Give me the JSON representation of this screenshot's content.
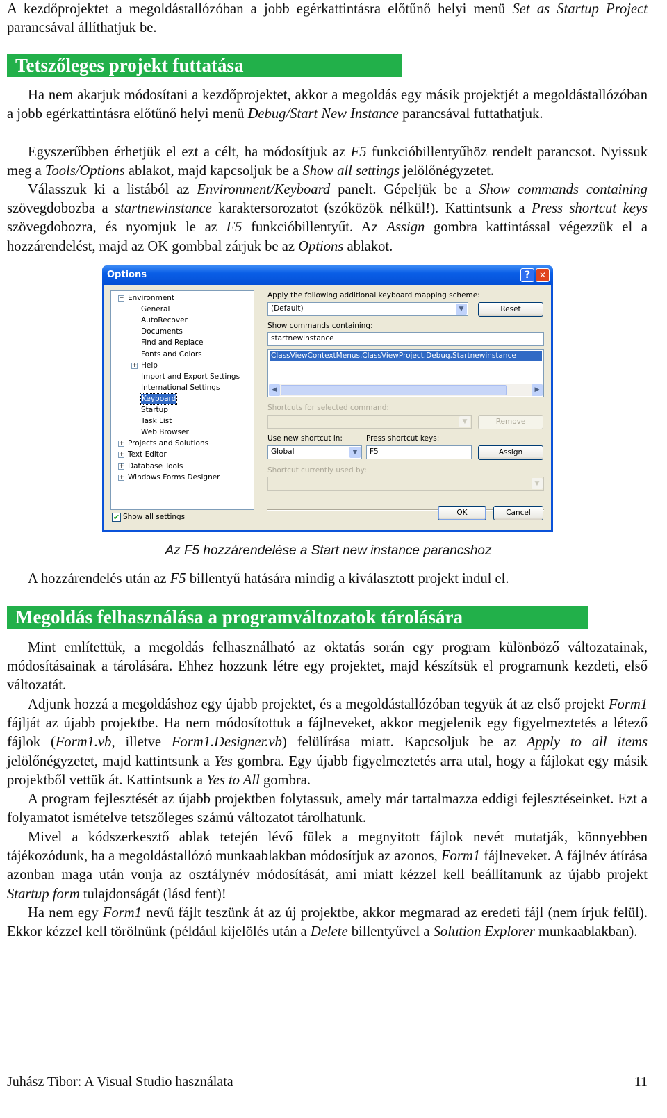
{
  "paragraphs": {
    "p0": [
      {
        "t": "A kezdőprojektet a megoldástallózóban a jobb egérkattintásra előtűnő helyi menü "
      },
      {
        "t": "Set as Startup Project",
        "i": true
      },
      {
        "t": " parancsával állíthatjuk be."
      }
    ],
    "p1": [
      {
        "t": "Ha nem akarjuk módosítani a kezdőprojektet, akkor a megoldás egy másik projektjét a megol­dástallózóban a jobb egérkattintásra előtűnő helyi menü "
      },
      {
        "t": "Debug/Start New Instance",
        "i": true
      },
      {
        "t": " parancsával futtathatjuk."
      }
    ],
    "p2": [
      {
        "t": "Egyszerűbben érhetjük el ezt a célt, ha módosítjuk az "
      },
      {
        "t": "F5",
        "i": true
      },
      {
        "t": " funkcióbillentyűhöz rendelt parancsot. Nyissuk meg a "
      },
      {
        "t": "Tools/Options",
        "i": true
      },
      {
        "t": " ablakot, majd kapcsoljuk be a "
      },
      {
        "t": "Show all settings",
        "i": true
      },
      {
        "t": " jelölőnégyzetet."
      }
    ],
    "p3": [
      {
        "t": "Válasszuk ki a listából az "
      },
      {
        "t": "Environment/Keyboard",
        "i": true
      },
      {
        "t": " panelt. Gépeljük be a "
      },
      {
        "t": "Show commands containing",
        "i": true
      },
      {
        "t": " szövegdobozba a "
      },
      {
        "t": "startnewinstance",
        "i": true
      },
      {
        "t": " karaktersorozatot (szóközök nélkül!). Kattintsunk a "
      },
      {
        "t": "Press shortcut keys",
        "i": true
      },
      {
        "t": " szövegdobozra, és nyomjuk le az "
      },
      {
        "t": "F5",
        "i": true
      },
      {
        "t": " funkcióbillentyűt. Az "
      },
      {
        "t": "Assign",
        "i": true
      },
      {
        "t": " gombra kat­tintással végezzük el a hozzárendelést, majd az OK gombbal zárjuk be az "
      },
      {
        "t": "Options",
        "i": true
      },
      {
        "t": " ablakot."
      }
    ],
    "p4": [
      {
        "t": "A hozzárendelés után az "
      },
      {
        "t": "F5",
        "i": true
      },
      {
        "t": " billentyű hatására mindig a kiválasztott projekt indul el."
      }
    ],
    "p5": [
      {
        "t": "Mint említettük, a megoldás felhasználható az oktatás során egy program különböző változatai­nak, módosításainak a tárolására. Ehhez hozzunk létre egy projektet, majd készítsük el programunk kezdeti, első változatát."
      }
    ],
    "p6": [
      {
        "t": "Adjunk hozzá a megoldáshoz egy újabb projektet, és a megoldástallózóban tegyük át az első projekt "
      },
      {
        "t": "Form1",
        "i": true
      },
      {
        "t": " fájlját az újabb projektbe. Ha nem módosítottuk a fájlneveket, akkor megjelenik egy figyelmeztetés a létező fájlok ("
      },
      {
        "t": "Form1.vb",
        "i": true
      },
      {
        "t": ", illetve "
      },
      {
        "t": "Form1.Designer.vb",
        "i": true
      },
      {
        "t": ") felülírása miatt. Kapcsoljuk be az "
      },
      {
        "t": "Apply to all items",
        "i": true
      },
      {
        "t": " jelölőnégyzetet, majd kattintsunk a "
      },
      {
        "t": "Yes",
        "i": true
      },
      {
        "t": " gombra. Egy újabb figyelmeztetés arra utal, hogy a fájlokat egy másik projektből vettük át. Kattintsunk a "
      },
      {
        "t": "Yes to All",
        "i": true
      },
      {
        "t": " gombra."
      }
    ],
    "p7": [
      {
        "t": "A program fejlesztését az újabb projektben folytassuk, amely már tartalmazza eddigi fejleszté­seinket. Ezt a folyamatot ismételve tetszőleges számú változatot tárolhatunk."
      }
    ],
    "p8": [
      {
        "t": "Mivel a kódszerkesztő ablak tetején lévő fülek a megnyitott fájlok nevét mutatják, könnyebben tájékozódunk, ha a megoldástallózó munkaablakban módosítjuk az azonos, "
      },
      {
        "t": "Form1",
        "i": true
      },
      {
        "t": " fájlneveket. A fájlnév átírása azonban maga után vonja az osztálynév módosítását, ami miatt kézzel kell beállíta­nunk az újabb projekt "
      },
      {
        "t": "Startup form",
        "i": true
      },
      {
        "t": " tulajdonságát (lásd fent)!"
      }
    ],
    "p9": [
      {
        "t": "Ha nem egy "
      },
      {
        "t": "Form1",
        "i": true
      },
      {
        "t": " nevű fájlt teszünk át az új projektbe, akkor megmarad az eredeti fájl (nem írjuk felül). Ekkor kézzel kell törölnünk (például kijelölés után a "
      },
      {
        "t": "Delete",
        "i": true
      },
      {
        "t": " billentyűvel a "
      },
      {
        "t": "Solution Explorer",
        "i": true
      },
      {
        "t": " munkaablakban)."
      }
    ]
  },
  "headings": {
    "h1": "Tetszőleges projekt futtatása",
    "h2": "Megoldás felhasználása a programváltozatok tárolására",
    "color": "#22b04a"
  },
  "caption": "Az F5 hozzárendelése a Start new instance parancshoz",
  "dialog": {
    "title": "Options",
    "help": "?",
    "close": "✕",
    "tree": [
      {
        "label": "Environment",
        "level": 0,
        "expander": "−"
      },
      {
        "label": "General",
        "level": 1
      },
      {
        "label": "AutoRecover",
        "level": 1
      },
      {
        "label": "Documents",
        "level": 1
      },
      {
        "label": "Find and Replace",
        "level": 1
      },
      {
        "label": "Fonts and Colors",
        "level": 1
      },
      {
        "label": "Help",
        "level": 1,
        "expander": "+"
      },
      {
        "label": "Import and Export Settings",
        "level": 1
      },
      {
        "label": "International Settings",
        "level": 1
      },
      {
        "label": "Keyboard",
        "level": 1,
        "selected": true
      },
      {
        "label": "Startup",
        "level": 1
      },
      {
        "label": "Task List",
        "level": 1
      },
      {
        "label": "Web Browser",
        "level": 1
      },
      {
        "label": "Projects and Solutions",
        "level": 0,
        "expander": "+"
      },
      {
        "label": "Text Editor",
        "level": 0,
        "expander": "+"
      },
      {
        "label": "Database Tools",
        "level": 0,
        "expander": "+"
      },
      {
        "label": "Windows Forms Designer",
        "level": 0,
        "expander": "+"
      }
    ],
    "mapping_label": "Apply the following additional keyboard mapping scheme:",
    "mapping_value": "(Default)",
    "reset": "Reset",
    "show_commands_label": "Show commands containing:",
    "show_commands_value": "startnewinstance",
    "command_selected": "ClassViewContextMenus.ClassViewProject.Debug.Startnewinstance",
    "shortcuts_label": "Shortcuts for selected command:",
    "remove": "Remove",
    "use_in_label": "Use new shortcut in:",
    "use_in_value": "Global",
    "press_keys_label": "Press shortcut keys:",
    "press_keys_value": "F5",
    "assign": "Assign",
    "used_by_label": "Shortcut currently used by:",
    "show_all_label": "Show all settings",
    "show_all_checked": true,
    "ok": "OK",
    "cancel": "Cancel"
  },
  "footer": {
    "left": "Juhász Tibor: A Visual Studio használata",
    "page": "11"
  }
}
